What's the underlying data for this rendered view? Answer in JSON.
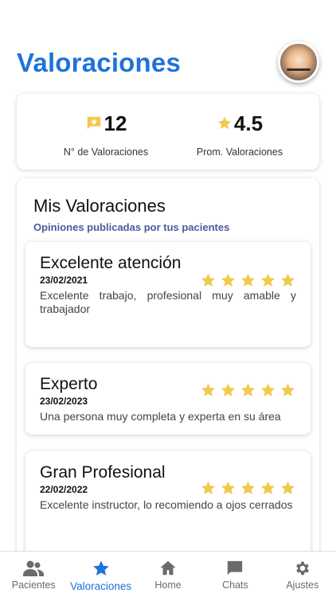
{
  "header": {
    "title": "Valoraciones"
  },
  "summary": {
    "count_value": "12",
    "count_label": "N° de Valoraciones",
    "avg_value": "4.5",
    "avg_label": "Prom. Valoraciones"
  },
  "reviews_section": {
    "title": "Mis Valoraciones",
    "subtitle": "Opiniones publicadas por tus pacientes",
    "items": [
      {
        "title": "Excelente atención",
        "date": "23/02/2021",
        "text": "Excelente trabajo, profesional muy amable y trabajador",
        "rating": 5
      },
      {
        "title": "Experto",
        "date": "23/02/2023",
        "text": "Una persona muy completa y experta en su área",
        "rating": 5
      },
      {
        "title": "Gran Profesional",
        "date": "22/02/2022",
        "text": "Excelente instructor, lo recomiendo a ojos cerrados",
        "rating": 5
      }
    ]
  },
  "nav": {
    "items": [
      {
        "label": "Pacientes",
        "icon": "people-icon"
      },
      {
        "label": "Valoraciones",
        "icon": "star-icon",
        "active": true
      },
      {
        "label": "Home",
        "icon": "home-icon"
      },
      {
        "label": "Chats",
        "icon": "chat-icon"
      },
      {
        "label": "Ajustes",
        "icon": "gear-icon"
      }
    ]
  },
  "colors": {
    "accent": "#1e73d8",
    "star": "#f4c84a",
    "subtitle": "#4a5aa0"
  }
}
